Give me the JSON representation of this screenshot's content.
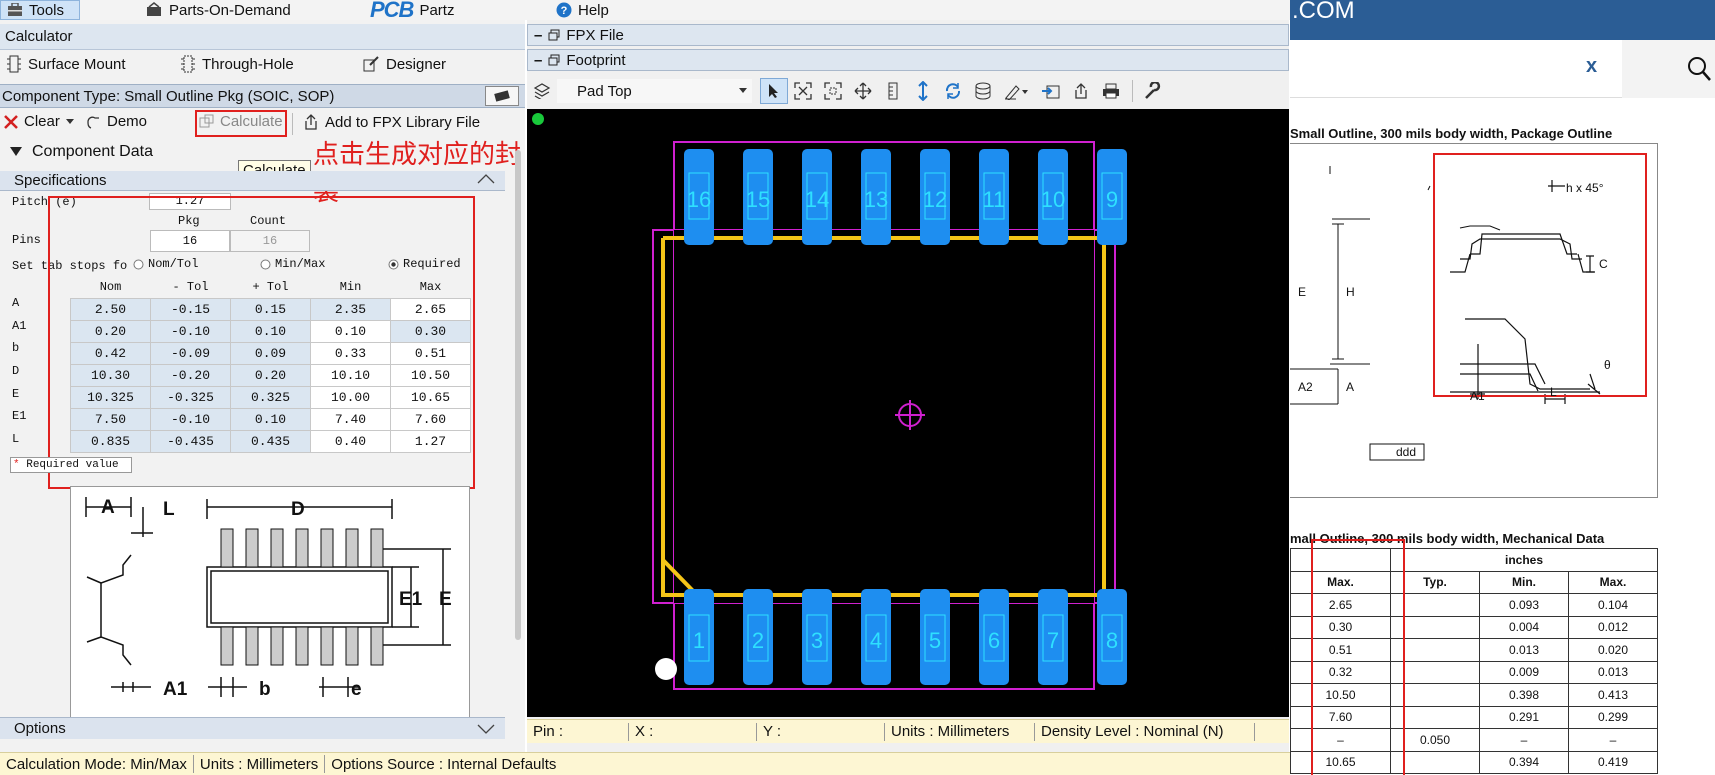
{
  "menu": {
    "tools": "Tools",
    "parts_on_demand": "Parts-On-Demand",
    "logo_pcb": "PCB",
    "logo_partz": "Partz",
    "help": "Help"
  },
  "left": {
    "calculator_title": "Calculator",
    "tabs": [
      "Surface Mount",
      "Through-Hole",
      "Designer"
    ],
    "component_type": "Component Type: Small Outline Pkg (SOIC, SOP)",
    "toolbar": {
      "clear": "Clear",
      "demo": "Demo",
      "calculate": "Calculate",
      "add_fpx": "Add to FPX Library File"
    },
    "annotation": "点击生成对应的封装",
    "tooltip": "Calculate",
    "component_data": "Component Data",
    "specifications": "Specifications",
    "pitch_label": "Pitch (e)",
    "pitch_value": "1.27",
    "pkg_header": "Pkg",
    "count_header": "Count",
    "pins_label": "Pins",
    "pins_pkg": "16",
    "pins_count": "16",
    "tabstops_label": "Set tab stops fo",
    "radio_nomtol": "Nom/Tol",
    "radio_minmax": "Min/Max",
    "radio_required": "Required",
    "table_headers": [
      "Nom",
      "- Tol",
      "+ Tol",
      "Min",
      "Max"
    ],
    "rows": [
      {
        "label": "A",
        "vals": [
          "2.50",
          "-0.15",
          "0.15",
          "2.35",
          "2.65"
        ]
      },
      {
        "label": "A1",
        "vals": [
          "0.20",
          "-0.10",
          "0.10",
          "0.10",
          "0.30"
        ]
      },
      {
        "label": "b",
        "vals": [
          "0.42",
          "-0.09",
          "0.09",
          "0.33",
          "0.51"
        ]
      },
      {
        "label": "D",
        "vals": [
          "10.30",
          "-0.20",
          "0.20",
          "10.10",
          "10.50"
        ]
      },
      {
        "label": "E",
        "vals": [
          "10.325",
          "-0.325",
          "0.325",
          "10.00",
          "10.65"
        ]
      },
      {
        "label": "E1",
        "vals": [
          "7.50",
          "-0.10",
          "0.10",
          "7.40",
          "7.60"
        ]
      },
      {
        "label": "L",
        "vals": [
          "0.835",
          "-0.435",
          "0.435",
          "0.40",
          "1.27"
        ]
      }
    ],
    "required_note": "Required value",
    "diagram_labels": {
      "A": "A",
      "L": "L",
      "D": "D",
      "E1": "E1",
      "E": "E",
      "A1": "A1",
      "b": "b",
      "e": "e"
    },
    "options": "Options"
  },
  "center": {
    "fpx_file": "FPX File",
    "footprint": "Footprint",
    "layer_select": "Pad Top",
    "top_pins": [
      "16",
      "15",
      "14",
      "13",
      "12",
      "11",
      "10",
      "9"
    ],
    "bottom_pins": [
      "1",
      "2",
      "3",
      "4",
      "5",
      "6",
      "7",
      "8"
    ],
    "status": {
      "pin": "Pin :",
      "x": "X :",
      "y": "Y :",
      "units": "Units :  Millimeters",
      "density": "Density Level :  Nominal (N)"
    }
  },
  "status_bottom": {
    "mode": "Calculation Mode:  Min/Max",
    "units": "Units :  Millimeters",
    "source": "Options Source :  Internal Defaults"
  },
  "right": {
    "header_text": ".COM",
    "close": "x",
    "outline_title": "Small Outline, 300 mils body width, Package Outline",
    "outline_labels": {
      "hx45": "h x 45°",
      "C": "C",
      "E": "E",
      "H": "H",
      "A2": "A2",
      "A": "A",
      "A1": "A1",
      "L": "L",
      "theta": "θ",
      "ddd": "ddd"
    },
    "mech_title": "mall Outline, 300 mils body width, Mechanical Data",
    "mech_inches": "inches",
    "mech_headers": [
      "Max.",
      "Typ.",
      "Min.",
      "Max."
    ],
    "mech_rows": [
      [
        "2.65",
        "",
        "0.093",
        "0.104"
      ],
      [
        "0.30",
        "",
        "0.004",
        "0.012"
      ],
      [
        "0.51",
        "",
        "0.013",
        "0.020"
      ],
      [
        "0.32",
        "",
        "0.009",
        "0.013"
      ],
      [
        "10.50",
        "",
        "0.398",
        "0.413"
      ],
      [
        "7.60",
        "",
        "0.291",
        "0.299"
      ],
      [
        "–",
        "0.050",
        "–",
        "–"
      ],
      [
        "10.65",
        "",
        "0.394",
        "0.419"
      ]
    ]
  },
  "colors": {
    "pad": "#1e8ef0",
    "silk": "#f5c518",
    "courtyard": "#d020d0",
    "pin_text": "#2ee0ff",
    "accent_red": "#e0201e",
    "site_blue": "#2b5d95"
  }
}
